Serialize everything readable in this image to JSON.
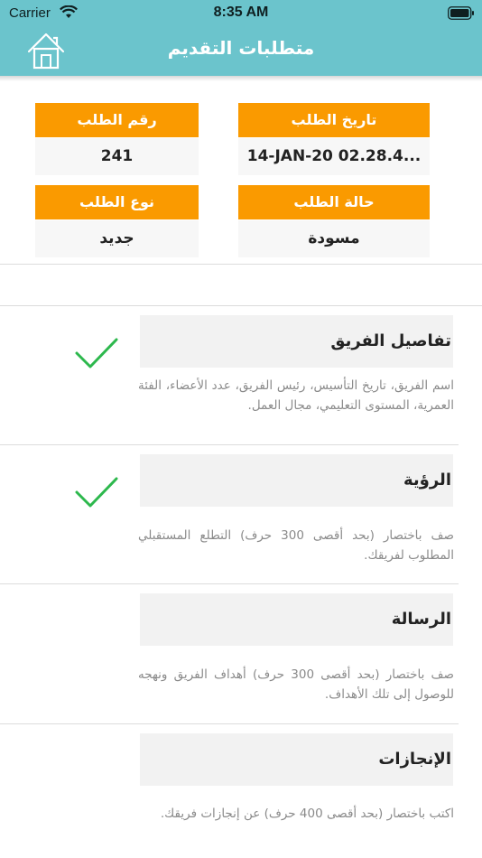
{
  "status_bar": {
    "carrier": "Carrier",
    "time": "8:35 AM"
  },
  "nav": {
    "title": "متطلبات التقديم",
    "home_icon": "home-icon"
  },
  "info": {
    "request_number": {
      "label": "رقم الطلب",
      "value": "241"
    },
    "request_date": {
      "label": "تاريخ الطلب",
      "value": "14-JAN-20 02.28.4..."
    },
    "request_type": {
      "label": "نوع الطلب",
      "value": "جديد"
    },
    "request_status": {
      "label": "حالة الطلب",
      "value": "مسودة"
    }
  },
  "sections": [
    {
      "title": "تفاصيل الفريق",
      "description": "اسم الفريق، تاريخ التأسيس، رئيس الفريق، عدد الأعضاء، الفئة العمرية، المستوى التعليمي، مجال العمل.",
      "completed": true
    },
    {
      "title": "الرؤية",
      "description": "صف باختصار (بحد أقصى 300 حرف) التطلع المستقبلي المطلوب لفريقك.",
      "completed": true
    },
    {
      "title": "الرسالة",
      "description": "صف باختصار (بحد أقصى 300 حرف) أهداف الفريق ونهجه للوصول إلى تلك الأهداف.",
      "completed": false
    },
    {
      "title": "الإنجازات",
      "description": "اكتب باختصار (بحد أقصى 400 حرف) عن إنجازات فريقك.",
      "completed": false
    }
  ],
  "colors": {
    "header": "#6bc4cc",
    "label_bg": "#fa9a00",
    "check": "#2db84d"
  }
}
